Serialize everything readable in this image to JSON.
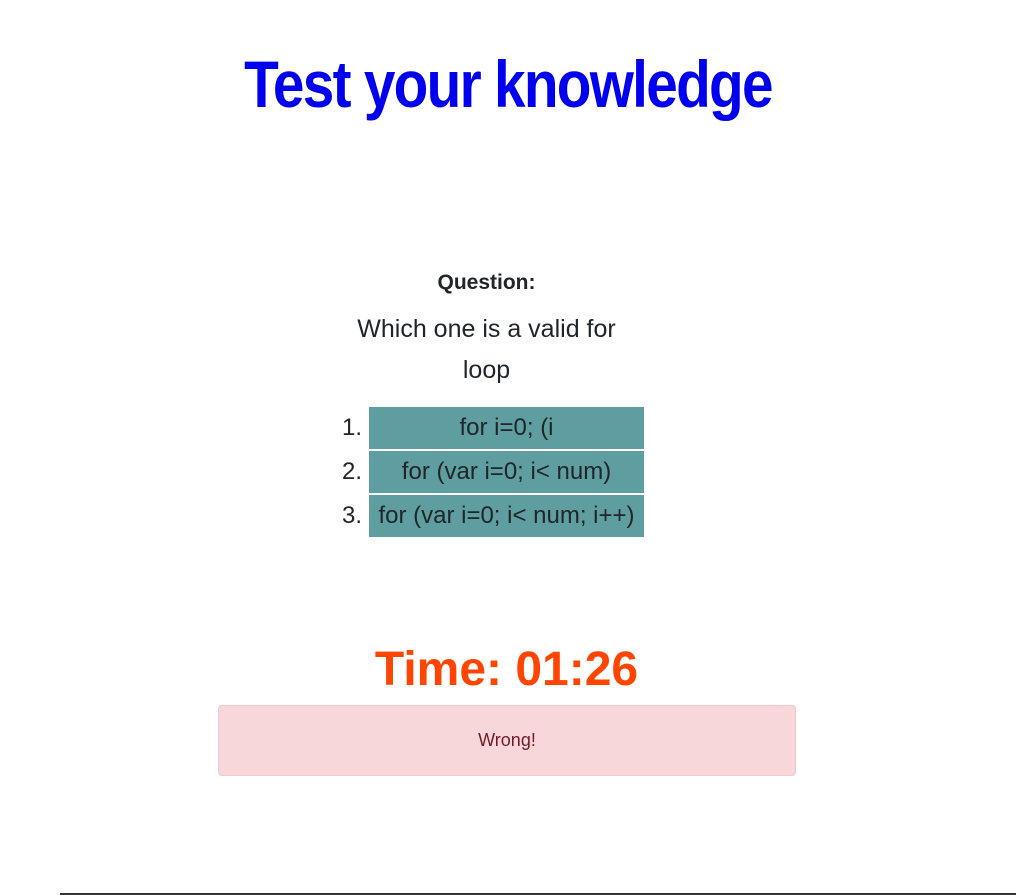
{
  "header": {
    "title": "Test your knowledge"
  },
  "quiz": {
    "question_label": "Question:",
    "question_text": "Which one is a valid for loop",
    "choices": [
      {
        "number": "1.",
        "label": "for i=0; (i"
      },
      {
        "number": "2.",
        "label": "for (var i=0; i< num)"
      },
      {
        "number": "3.",
        "label": "for (var i=0; i< num; i++)"
      }
    ]
  },
  "timer": {
    "text": "Time: 01:26"
  },
  "feedback": {
    "message": "Wrong!"
  },
  "colors": {
    "title": "#0000ee",
    "choice_background": "#5f9ea0",
    "timer": "#ff4500",
    "alert_background": "#f8d7da",
    "alert_text": "#721c24"
  }
}
